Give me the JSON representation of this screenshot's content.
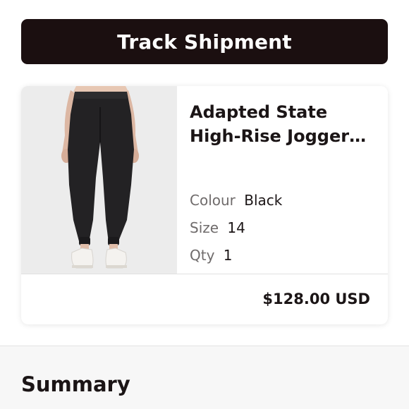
{
  "track_button": {
    "label": "Track Shipment"
  },
  "product": {
    "image_icon": "jogger-pants-photo",
    "title": "Adapted State High-Rise Jogger *Full Length",
    "colour_label": "Colour",
    "colour_value": "Black",
    "size_label": "Size",
    "size_value": "14",
    "qty_label": "Qty",
    "qty_value": "1",
    "price": "$128.00 USD"
  },
  "summary": {
    "title": "Summary"
  },
  "colors": {
    "button_bg": "#1b0f10",
    "text_primary": "#1b1516",
    "text_secondary": "#6f6b6b",
    "section_bg": "#f7f7f7"
  }
}
